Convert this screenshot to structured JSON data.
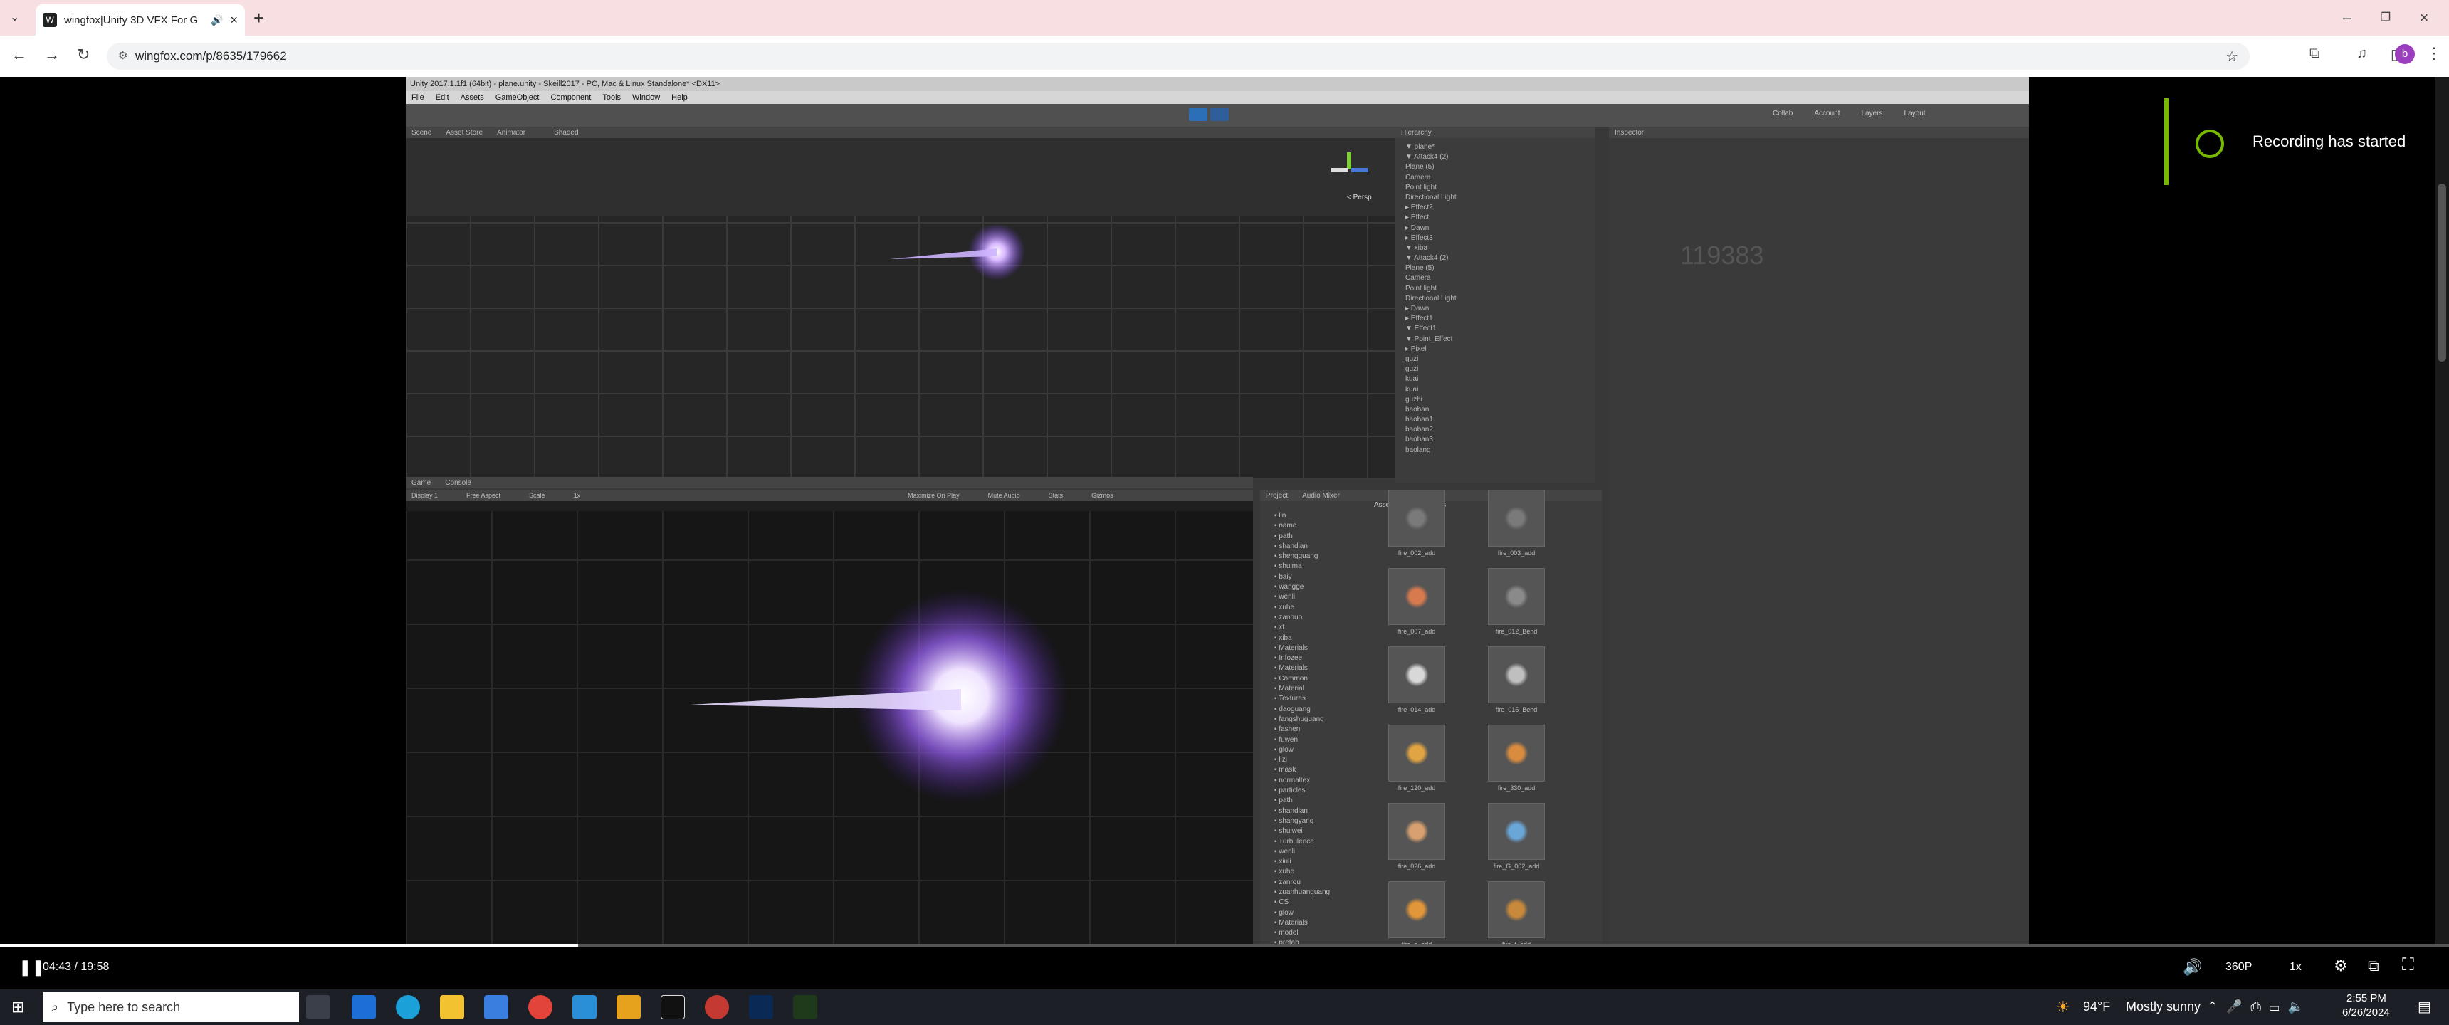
{
  "browser": {
    "tab_title": "wingfox|Unity 3D VFX For G",
    "tab_favicon": "W",
    "url": "wingfox.com/p/8635/179662",
    "profile_initial": "b"
  },
  "unity": {
    "window_title": "Unity 2017.1.1f1 (64bit) - plane.unity - Skeill2017 - PC, Mac & Linux Standalone* <DX11>",
    "menu": [
      "File",
      "Edit",
      "Assets",
      "GameObject",
      "Component",
      "Tools",
      "Window",
      "Help"
    ],
    "scene_tabs": [
      "Scene",
      "Asset Store",
      "Animator"
    ],
    "scene_shading": "Shaded",
    "persp_label": "< Persp",
    "hierarchy_title": "Hierarchy",
    "hierarchy_rows": [
      "▼ plane*",
      "▼ Attack4 (2)",
      "Plane (5)",
      "Camera",
      "Point light",
      "Directional Light",
      "▸ Effect2",
      "▸ Effect",
      "▸ Dawn",
      "▸ Effect3",
      "▼ xiba",
      "▼ Attack4 (2)",
      "Plane (5)",
      "Camera",
      "Point light",
      "Directional Light",
      "▸ Dawn",
      "▸ Effect1",
      "▼ Effect1",
      "▼ Point_Effect",
      "▸ Pixel",
      "guzi",
      "guzi",
      "kuai",
      "kuai",
      "guzhi",
      "baoban",
      "baoban1",
      "baoban2",
      "baoban3",
      "baolang"
    ],
    "inspector_title": "Inspector",
    "inspector_number": "119383",
    "top_right_buttons": [
      "Collab",
      "Account",
      "Layers",
      "Layout"
    ],
    "game_tabs": [
      "Game",
      "Console"
    ],
    "game_toolbar": [
      "Display 1",
      "Free Aspect",
      "Scale",
      "1x",
      "Maximize On Play",
      "Mute Audio",
      "Stats",
      "Gizmos"
    ],
    "project_tabs": [
      "Project",
      "Audio Mixer"
    ],
    "project_breadcrumb": "Assets > xf > Materials",
    "project_tree": [
      "lin",
      "name",
      "path",
      "shandian",
      "shengguang",
      "shuima",
      "baiy",
      "wangge",
      "wenli",
      "xuhe",
      "zanhuo",
      "xf",
      "xiba",
      "Materials",
      "Infozee",
      "Materials",
      "Common",
      "Material",
      "Textures",
      "daoguang",
      "fangshuguang",
      "fashen",
      "fuwen",
      "glow",
      "lizi",
      "mask",
      "normaltex",
      "particles",
      "path",
      "shandian",
      "shangyang",
      "shuiwei",
      "Turbulence",
      "wenli",
      "xiuli",
      "xuhe",
      "zanrou",
      "zuanhuanguang",
      "CS",
      "glow",
      "Materials",
      "model",
      "prefab"
    ],
    "materials": [
      {
        "label": "fire_002_add",
        "color": "#7a7a7a"
      },
      {
        "label": "fire_003_add",
        "color": "#7a7a7a"
      },
      {
        "label": "fire_007_add",
        "color": "#d77a4e"
      },
      {
        "label": "fire_012_Bend",
        "color": "#8a8a8a"
      },
      {
        "label": "fire_014_add",
        "color": "#d8d8d8"
      },
      {
        "label": "fire_015_Bend",
        "color": "#bfbfbf"
      },
      {
        "label": "fire_120_add",
        "color": "#e0a442"
      },
      {
        "label": "fire_330_add",
        "color": "#d98b3e"
      },
      {
        "label": "fire_026_add",
        "color": "#d8a070"
      },
      {
        "label": "fire_G_002_add",
        "color": "#6aa6d8"
      },
      {
        "label": "fire_e_add",
        "color": "#e2963a"
      },
      {
        "label": "fire_f_add",
        "color": "#c88a3a"
      }
    ]
  },
  "recording": {
    "message": "Recording has started"
  },
  "player": {
    "current_time": "04:43",
    "duration": "19:58",
    "time_display": "04:43 / 19:58",
    "progress": 0.236,
    "quality": "360P",
    "speed": "1x"
  },
  "taskbar": {
    "search_placeholder": "Type here to search",
    "weather_temp": "94°F",
    "weather_text": "Mostly sunny",
    "time": "2:55 PM",
    "date": "6/26/2024"
  }
}
